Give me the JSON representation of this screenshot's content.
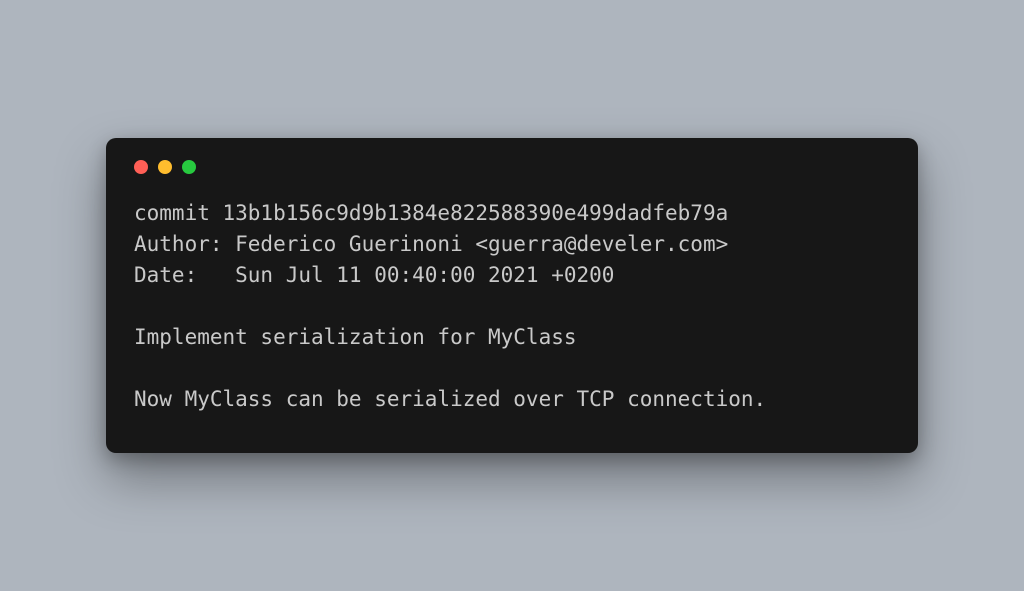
{
  "colors": {
    "background": "#aeb5be",
    "terminal": "#171717",
    "text": "#c9c9c9",
    "dot_red": "#ff5f56",
    "dot_yellow": "#ffbd2e",
    "dot_green": "#27c93f"
  },
  "titlebar": {
    "buttons": [
      "close",
      "minimize",
      "maximize"
    ]
  },
  "commit": {
    "hash_line": "commit 13b1b156c9d9b1384e822588390e499dadfeb79a",
    "author_line": "Author: Federico Guerinoni <guerra@develer.com>",
    "date_line": "Date:   Sun Jul 11 00:40:00 2021 +0200",
    "blank1": "",
    "subject": "Implement serialization for MyClass",
    "blank2": "",
    "body": "Now MyClass can be serialized over TCP connection."
  }
}
